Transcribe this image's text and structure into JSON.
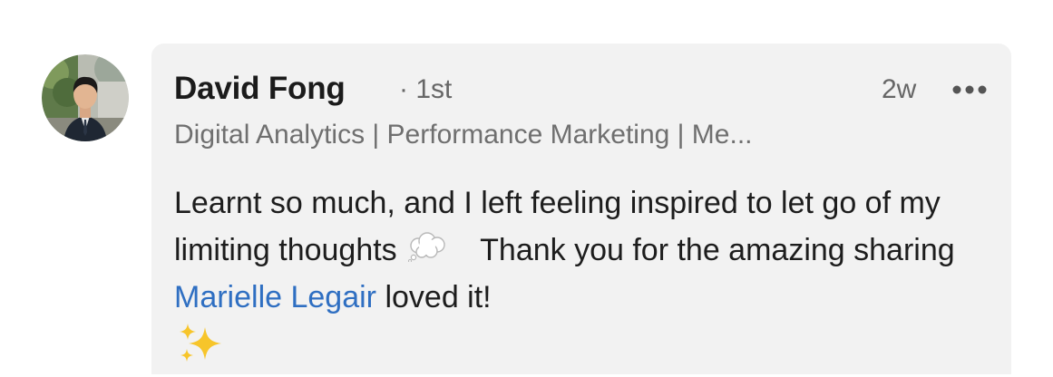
{
  "comment": {
    "author": {
      "name": "David Fong",
      "connection_degree": "· 1st",
      "headline": "Digital Analytics | Performance Marketing | Me...",
      "avatar_icon": "profile-photo"
    },
    "timestamp": "2w",
    "more_icon": "more-options-icon",
    "body": {
      "part1": "Learnt so much, and I left feeling inspired to let go of my limiting thoughts",
      "thought_emoji": "thought-balloon-icon",
      "part2": "Thank you for the amazing sharing",
      "mention": "Marielle Legair",
      "part3": "loved it!",
      "sparkles_emoji": "sparkles-icon"
    },
    "colors": {
      "bubble_background": "#f2f2f2",
      "mention_link": "#2f6fc2",
      "secondary_text": "#666666"
    }
  }
}
